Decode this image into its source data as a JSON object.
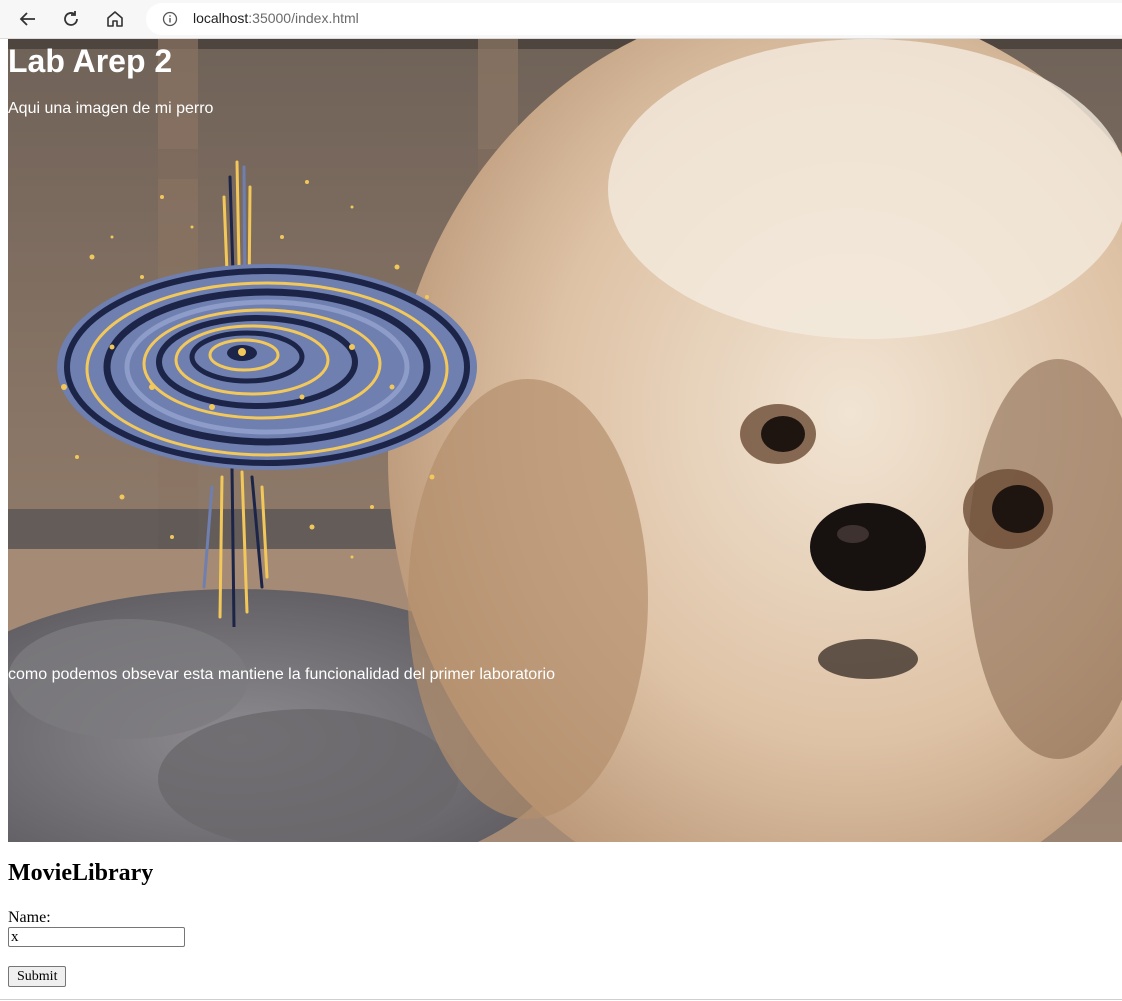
{
  "browser": {
    "url_host": "localhost",
    "url_path": ":35000/index.html",
    "icons": [
      "back-arrow-icon",
      "reload-icon",
      "home-icon",
      "info-icon"
    ]
  },
  "hero": {
    "title": "Lab Arep 2",
    "intro": "Aqui una imagen de mi perro",
    "caption": "como podemos obsevar esta mantiene la funcionalidad del primer laboratorio"
  },
  "form": {
    "title": "MovieLibrary",
    "name_label": "Name:",
    "name_value": "x",
    "submit_label": "Submit"
  },
  "colors": {
    "galaxy_blue": "#6e7fb0",
    "galaxy_navy": "#1c2448",
    "galaxy_gold": "#f2c85b"
  }
}
